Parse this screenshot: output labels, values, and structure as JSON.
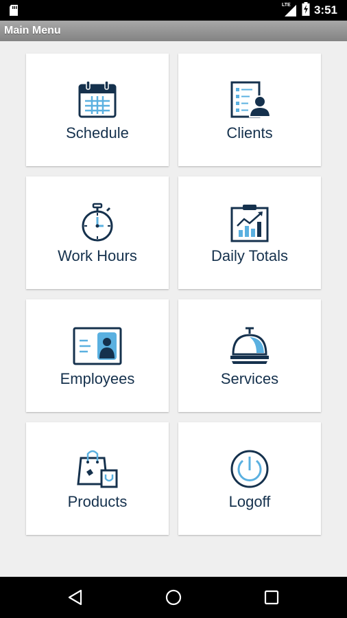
{
  "status_bar": {
    "time": "3:51",
    "network": "LTE",
    "icons": [
      "sd-card-icon",
      "signal-icon",
      "battery-charging-icon"
    ]
  },
  "title_bar": {
    "title": "Main Menu"
  },
  "menu": {
    "tiles": [
      {
        "label": "Schedule",
        "icon": "calendar-icon"
      },
      {
        "label": "Clients",
        "icon": "client-list-icon"
      },
      {
        "label": "Work Hours",
        "icon": "stopwatch-icon"
      },
      {
        "label": "Daily Totals",
        "icon": "chart-clipboard-icon"
      },
      {
        "label": "Employees",
        "icon": "id-card-icon"
      },
      {
        "label": "Services",
        "icon": "service-bell-icon"
      },
      {
        "label": "Products",
        "icon": "shopping-bags-icon"
      },
      {
        "label": "Logoff",
        "icon": "power-icon"
      }
    ]
  },
  "nav_bar": {
    "buttons": [
      "back-icon",
      "home-icon",
      "recents-icon"
    ]
  },
  "colors": {
    "icon_dark": "#15314d",
    "icon_accent": "#5ab0e0",
    "label": "#15314d",
    "background": "#efefef",
    "tile": "#ffffff"
  }
}
